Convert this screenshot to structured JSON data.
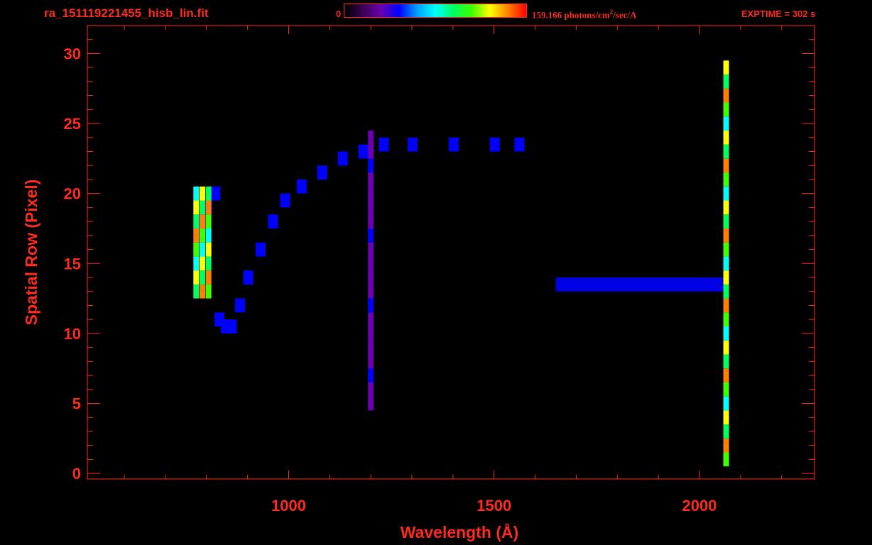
{
  "header": {
    "file_title": "ra_151119221455_hisb_lin.fit",
    "colorbar_min": "0",
    "colorbar_max_value": "159.166",
    "colorbar_units_before": " photons/cm",
    "colorbar_units_sup": "2",
    "colorbar_units_after": "/sec/A",
    "exptime": "EXPTIME = 302 s"
  },
  "colors": {
    "axis": "#ff2b1d",
    "background": "#000000",
    "colorbar": [
      "#000000",
      "#3a0050",
      "#6a00b0",
      "#0000ff",
      "#00a0ff",
      "#00ffff",
      "#00ff60",
      "#40ff00",
      "#ffff00",
      "#ff8000",
      "#ff0000"
    ]
  },
  "chart_data": {
    "type": "heatmap",
    "title": "ra_151119221455_hisb_lin.fit",
    "xlabel": "Wavelength (Å)",
    "ylabel": "Spatial Row (Pixel)",
    "xlim": [
      510,
      2280
    ],
    "ylim": [
      -0.4,
      32
    ],
    "xticks": [
      1000,
      1500,
      2000
    ],
    "yticks": [
      0,
      5,
      10,
      15,
      20,
      25,
      30
    ],
    "grid": false,
    "colorbar_range": [
      0,
      159.166
    ],
    "colorbar_units": "photons/cm²/sec/A",
    "features": [
      {
        "name": "left-arc",
        "x": [
          780,
          790,
          800,
          810,
          820,
          830,
          845,
          860,
          880,
          900,
          930,
          960,
          990,
          1030,
          1080,
          1130,
          1180,
          1230,
          1300,
          1400,
          1500,
          1560
        ],
        "y": [
          17,
          18,
          19,
          20,
          20,
          11,
          10.5,
          10.5,
          12,
          14,
          16,
          18,
          19.5,
          20.5,
          21.5,
          22.5,
          23,
          23.5,
          23.5,
          23.5,
          23.5,
          23.5
        ],
        "level": 0.25
      },
      {
        "name": "bright-left-lobe",
        "x": [
          775,
          790,
          805
        ],
        "y_range": [
          13,
          20
        ],
        "level": 0.85
      },
      {
        "name": "vertical-line-1200",
        "x": [
          1200
        ],
        "y_range": [
          5,
          24
        ],
        "level": 0.25
      },
      {
        "name": "horizontal-band",
        "x_range": [
          1650,
          2060
        ],
        "y": [
          13.5
        ],
        "level": 0.3
      },
      {
        "name": "right-edge",
        "x": [
          2065
        ],
        "y_range": [
          1,
          29
        ],
        "level": 0.9
      }
    ]
  }
}
